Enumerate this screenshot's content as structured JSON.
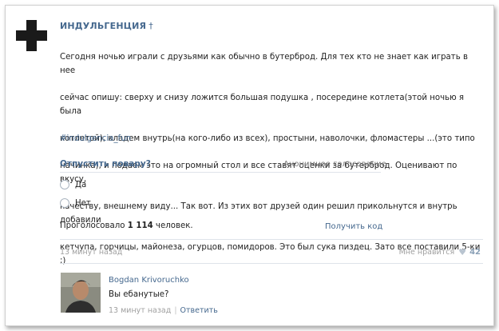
{
  "post": {
    "author": "ИНДУЛЬГЕНЦИЯ",
    "author_badge": "†",
    "avatar_icon": "black-cross-icon",
    "text_lines": [
      "Сегодня ночью играли с друзьями как обычно в бутерброд. Для тех кто не знает как играть в нее",
      "сейчас опишу: сверху и снизу ложится большая подушка , посередине котлета(этой ночью я была",
      "котлетой), кладем внутрь(на кого-либо из всех), простыни, наволочки, фломастеры ...(это типо",
      "начинка), и подаем это на огромный стол и все ставят оценки за бутерброд. Оценивают по вкусу,",
      "качеству, внешнему виду... Так вот. Из этих вот друзей один решил прикольнутся и внутрь добавили",
      "кетчупа, горчицы, майонеза, огурцов, помидоров. Это был сука пиздец. Зато все поставили 5-ки ;)"
    ],
    "hashtag": "#indulgencia_fun",
    "time": "13 минут назад",
    "likes_label": "Мне нравится",
    "likes_count": "42"
  },
  "poll": {
    "title": "Отпустить повару?",
    "type": "Анонимное голосование",
    "options": [
      "Да",
      "Нет"
    ],
    "votes_prefix": "Проголосовало",
    "votes_count": "1 114",
    "votes_suffix": "человек.",
    "get_code": "Получить код"
  },
  "comment": {
    "author": "Bogdan Krivoruchko",
    "text": "Вы ебанутые?",
    "time": "13 минут назад",
    "separator": "|",
    "reply": "Ответить"
  },
  "colors": {
    "link": "#45688e",
    "muted": "#a0a0a0",
    "divider": "#dfe4ea"
  }
}
